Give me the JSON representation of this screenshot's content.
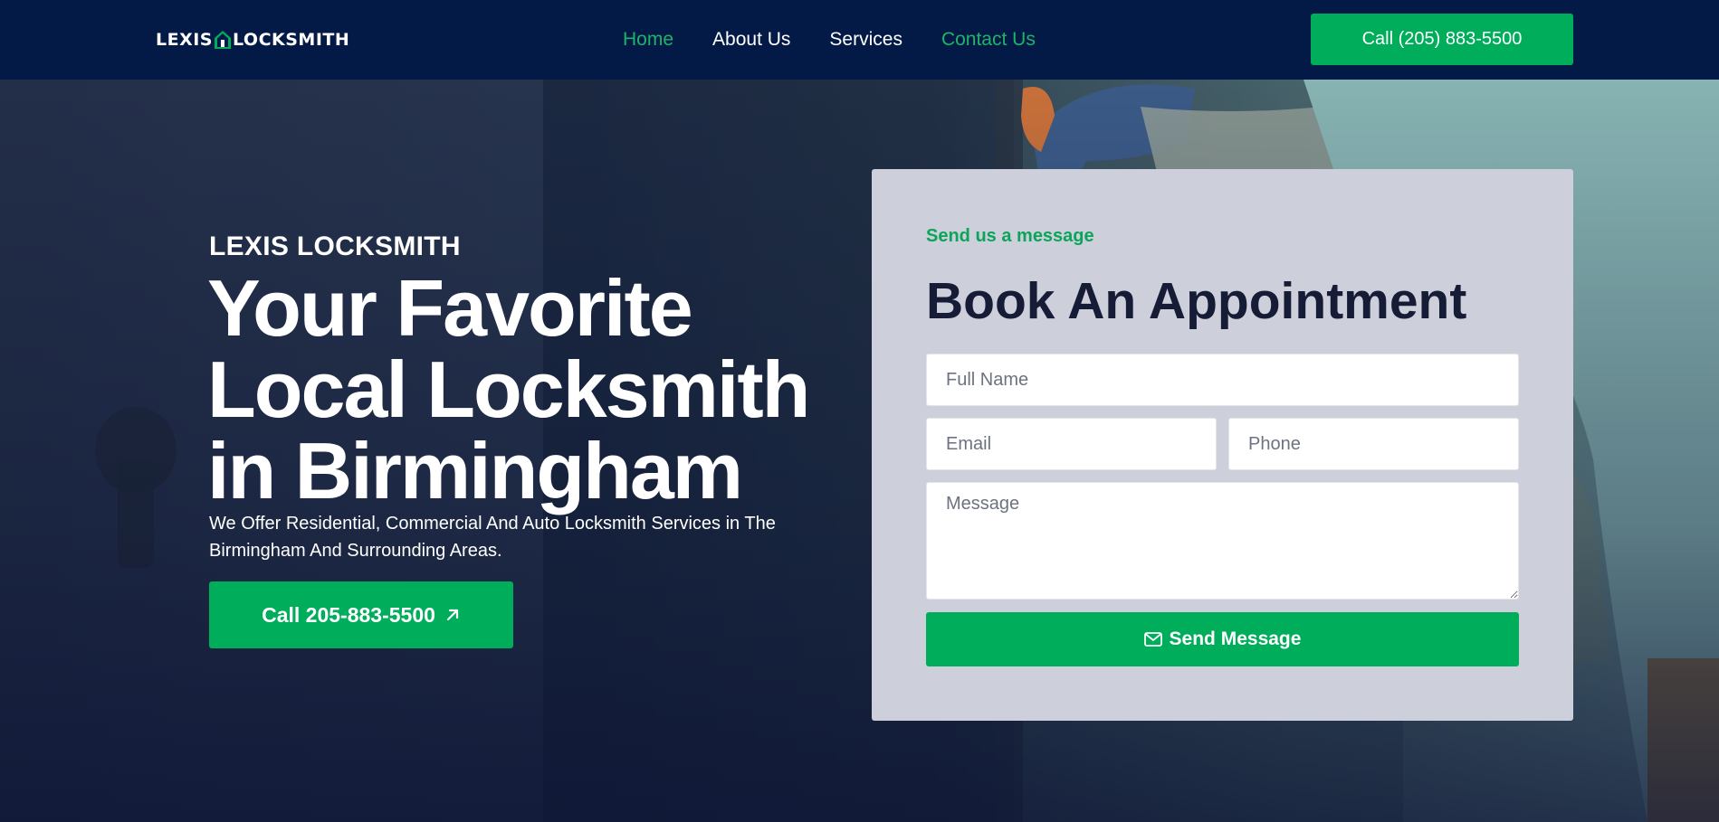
{
  "nav": {
    "logo_left": "LEXIS",
    "logo_right": "LOCKSMITH",
    "links": [
      {
        "label": "Home",
        "active": true
      },
      {
        "label": "About Us",
        "active": false
      },
      {
        "label": "Services",
        "active": false
      },
      {
        "label": "Contact Us",
        "active": true
      }
    ],
    "call_label": "Call (205) 883-5500"
  },
  "hero": {
    "eyebrow": "LEXIS LOCKSMITH",
    "headline_line1": "Your Favorite",
    "headline_line2": "Local Locksmith",
    "headline_line3": "in Birmingham",
    "subtext": "We Offer Residential, Commercial And Auto Locksmith Services in The Birmingham And Surrounding Areas.",
    "call_label": "Call 205-883-5500",
    "call_icon": "arrow-up-right-icon"
  },
  "form": {
    "eyebrow": "Send us a message",
    "title": "Book An Appointment",
    "name_placeholder": "Full Name",
    "email_placeholder": "Email",
    "phone_placeholder": "Phone",
    "message_placeholder": "Message",
    "submit_label": "Send Message",
    "submit_icon": "envelope-icon"
  },
  "colors": {
    "nav_bg": "#031a47",
    "accent_green": "#00ad5b",
    "card_bg": "#cdd0da",
    "title_dark": "#161c36"
  }
}
